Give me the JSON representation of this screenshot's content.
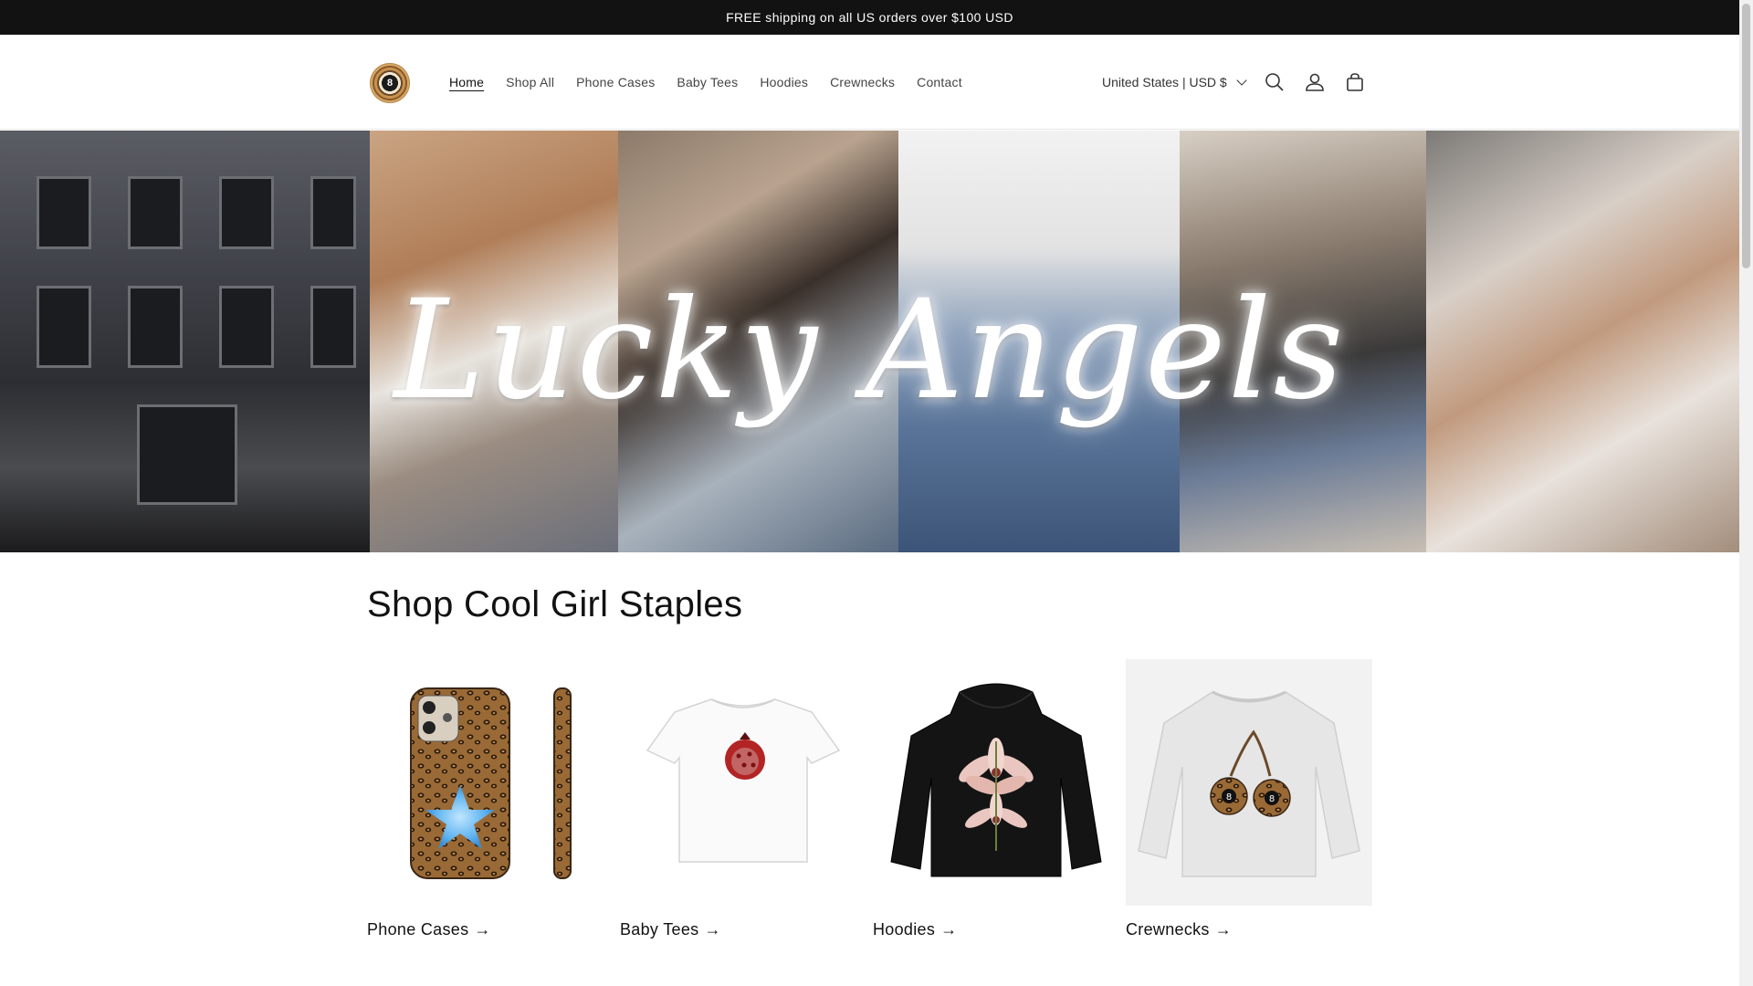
{
  "announcement": "FREE shipping on all US orders over $100 USD",
  "logo": {
    "text": "8"
  },
  "nav": [
    "Home",
    "Shop All",
    "Phone Cases",
    "Baby Tees",
    "Hoodies",
    "Crewnecks",
    "Contact"
  ],
  "locale": "United States | USD $",
  "header_icons": [
    "search-icon",
    "account-icon",
    "cart-icon"
  ],
  "hero": {
    "title": "Lucky Angels"
  },
  "section": {
    "title": "Shop Cool Girl Staples",
    "collections": [
      {
        "label": "Phone Cases"
      },
      {
        "label": "Baby Tees"
      },
      {
        "label": "Hoodies"
      },
      {
        "label": "Crewnecks"
      }
    ]
  },
  "colors": {
    "announcement_bg": "#121212",
    "text": "#121212",
    "leopard": "#8a5a2b",
    "star": "#5fb3f0"
  }
}
